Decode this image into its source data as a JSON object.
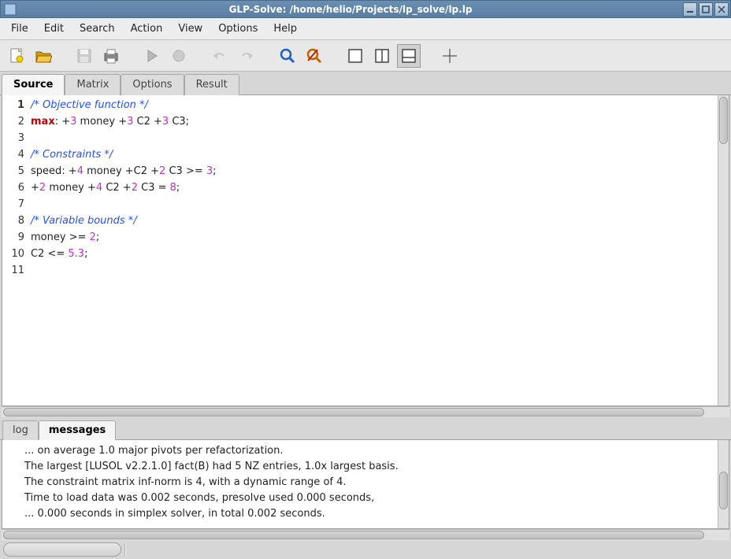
{
  "window": {
    "title": "GLP-Solve: /home/helio/Projects/lp_solve/lp.lp"
  },
  "menu": {
    "file": "File",
    "edit": "Edit",
    "search": "Search",
    "action": "Action",
    "view": "View",
    "options": "Options",
    "help": "Help"
  },
  "tabs": {
    "source": "Source",
    "matrix": "Matrix",
    "options": "Options",
    "result": "Result"
  },
  "source_lines": [
    {
      "n": "1",
      "html": "<span class='cm'>/* Objective function */</span>"
    },
    {
      "n": "2",
      "html": "<span class='kw'>max</span>: +<span class='num'>3</span> money +<span class='num'>3</span> C2 +<span class='num'>3</span> C3;"
    },
    {
      "n": "3",
      "html": ""
    },
    {
      "n": "4",
      "html": "<span class='cm'>/* Constraints */</span>"
    },
    {
      "n": "5",
      "html": "speed: +<span class='num'>4</span> money +C2 +<span class='num'>2</span> C3 >= <span class='co'>3</span>;"
    },
    {
      "n": "6",
      "html": "+<span class='num'>2</span> money +<span class='num'>4</span> C2 +<span class='num'>2</span> C3 = <span class='co'>8</span>;"
    },
    {
      "n": "7",
      "html": ""
    },
    {
      "n": "8",
      "html": "<span class='cm'>/* Variable bounds */</span>"
    },
    {
      "n": "9",
      "html": "money >= <span class='co'>2</span>;"
    },
    {
      "n": "10",
      "html": "C2 <= <span class='co'>5.3</span>;"
    },
    {
      "n": "11",
      "html": ""
    }
  ],
  "current_line": 1,
  "bottom_tabs": {
    "log": "log",
    "messages": "messages"
  },
  "messages": [
    "... on average 1.0 major pivots per refactorization.",
    "The largest [LUSOL v2.2.1.0] fact(B) had 5 NZ entries, 1.0x largest basis.",
    "The constraint matrix inf-norm is 4, with a dynamic range of 4.",
    "Time to load data was 0.002 seconds, presolve used 0.000 seconds,",
    "... 0.000 seconds in simplex solver, in total 0.002 seconds."
  ]
}
